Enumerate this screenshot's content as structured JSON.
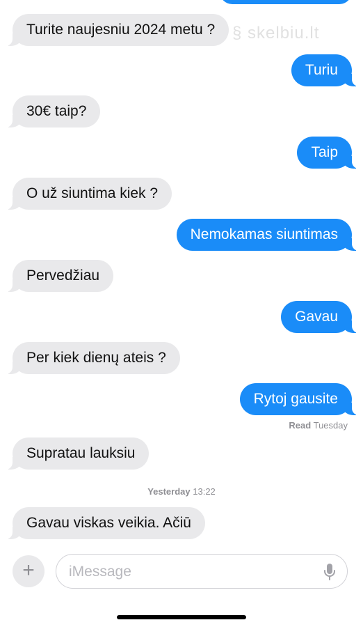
{
  "watermark": "§ skelbiu.lt",
  "messages": [
    {
      "dir": "in",
      "text": "Turite naujesniu 2024 metu ?"
    },
    {
      "dir": "out",
      "text": "Turiu"
    },
    {
      "dir": "in",
      "text": "30€ taip?"
    },
    {
      "dir": "out",
      "text": "Taip"
    },
    {
      "dir": "in",
      "text": "O už siuntima kiek ?"
    },
    {
      "dir": "out",
      "text": "Nemokamas siuntimas"
    },
    {
      "dir": "in",
      "text": "Pervedžiau"
    },
    {
      "dir": "out",
      "text": "Gavau"
    },
    {
      "dir": "in",
      "text": "Per kiek dienų ateis ?"
    },
    {
      "dir": "out",
      "text": "Rytoj gausite"
    },
    {
      "dir": "in",
      "text": "Supratau lauksiu"
    },
    {
      "dir": "in",
      "text": "Gavau viskas veikia. Ačiū"
    }
  ],
  "receipt": {
    "label": "Read",
    "value": "Tuesday"
  },
  "timestamp": {
    "day": "Yesterday",
    "time": "13:22"
  },
  "composer": {
    "placeholder": "iMessage",
    "plus": "+",
    "mic_icon": "microphone-icon"
  },
  "colors": {
    "outgoing": "#1a8cf8",
    "incoming": "#e9e9eb",
    "meta": "#8e8e93"
  }
}
